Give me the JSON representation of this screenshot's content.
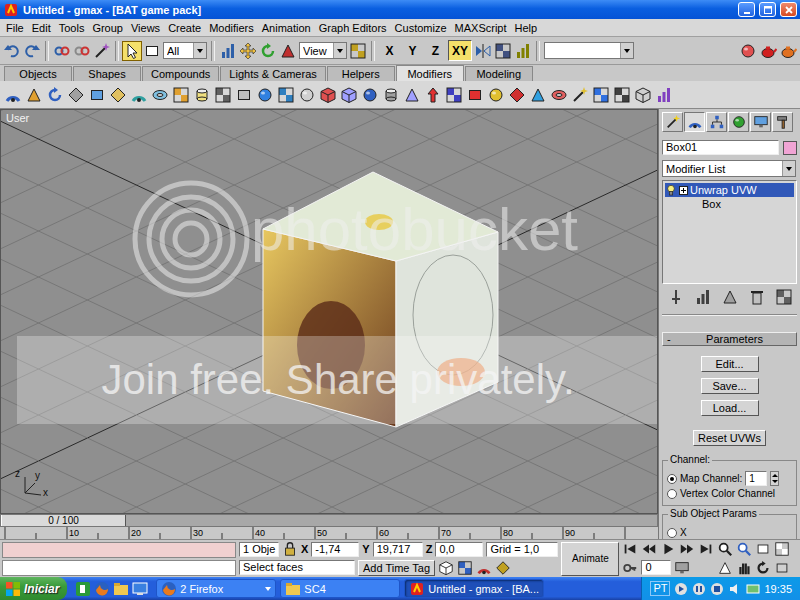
{
  "window": {
    "title": "Untitled - gmax - [BAT game pack]"
  },
  "menu": [
    "File",
    "Edit",
    "Tools",
    "Group",
    "Views",
    "Create",
    "Modifiers",
    "Animation",
    "Graph Editors",
    "Customize",
    "MAXScript",
    "Help"
  ],
  "toolbar": {
    "selection_filter": "All",
    "reference_coord": "View",
    "axis_buttons": [
      {
        "label": "X",
        "selected": false
      },
      {
        "label": "Y",
        "selected": false
      },
      {
        "label": "Z",
        "selected": false
      },
      {
        "label": "XY",
        "selected": true
      }
    ]
  },
  "tabs": [
    {
      "label": "Objects",
      "selected": false
    },
    {
      "label": "Shapes",
      "selected": false
    },
    {
      "label": "Compounds",
      "selected": false
    },
    {
      "label": "Lights & Cameras",
      "selected": false
    },
    {
      "label": "Helpers",
      "selected": false
    },
    {
      "label": "Modifiers",
      "selected": true
    },
    {
      "label": "Modeling",
      "selected": false
    }
  ],
  "viewport": {
    "label": "User",
    "axis_labels": [
      "y",
      "x",
      "z"
    ],
    "watermark": {
      "logo": "photobucket",
      "banner": "Join free. Share privately."
    }
  },
  "time_slider": {
    "label": "0 / 100",
    "level": 0
  },
  "track_bar": {
    "ticks": [
      "10",
      "20",
      "30",
      "40",
      "50",
      "60",
      "70",
      "80",
      "90"
    ]
  },
  "command_panel": {
    "tabs": [
      {
        "selected": false
      },
      {
        "selected": true
      },
      {
        "selected": false
      },
      {
        "selected": false
      },
      {
        "selected": false
      },
      {
        "selected": false
      }
    ],
    "object_name": "Box01",
    "modifier_list": "Modifier List",
    "stack": [
      {
        "label": "Unwrap UVW",
        "kind": "modifier",
        "selected": true,
        "expanded": false
      },
      {
        "label": "Box",
        "kind": "base",
        "selected": false,
        "expanded": false
      }
    ],
    "rollout": {
      "title": "Parameters",
      "toggle": "-",
      "buttons": [
        "Edit...",
        "Save...",
        "Load...",
        "Reset UVWs"
      ],
      "channel": {
        "title": "Channel:",
        "options": [
          {
            "label": "Map Channel:",
            "selected": true
          },
          {
            "label": "Vertex Color Channel",
            "selected": false
          }
        ],
        "map_channel": "1"
      },
      "sub_object": {
        "title": "Sub Object Params",
        "options": [
          {
            "label": "X",
            "selected": false
          }
        ]
      }
    }
  },
  "status": {
    "selection": "1 Obje",
    "coords": [
      {
        "axis": "X",
        "value": "-1,74"
      },
      {
        "axis": "Y",
        "value": "19,717"
      },
      {
        "axis": "Z",
        "value": "0,0"
      }
    ],
    "grid": "Grid = 1,0",
    "prompt": "Select faces",
    "time_tag": "Add Time Tag",
    "animate": {
      "label": "Animate",
      "on": false
    },
    "frame": "0"
  },
  "taskbar": {
    "start": "Iniciar",
    "tasks": [
      {
        "label": "2 Firefox",
        "kind": "group",
        "selected": false
      },
      {
        "label": "SC4",
        "kind": "window",
        "selected": false
      },
      {
        "label": "Untitled - gmax - [BA...",
        "kind": "window",
        "selected": true
      }
    ],
    "language": "PT",
    "clock": "19:35"
  }
}
